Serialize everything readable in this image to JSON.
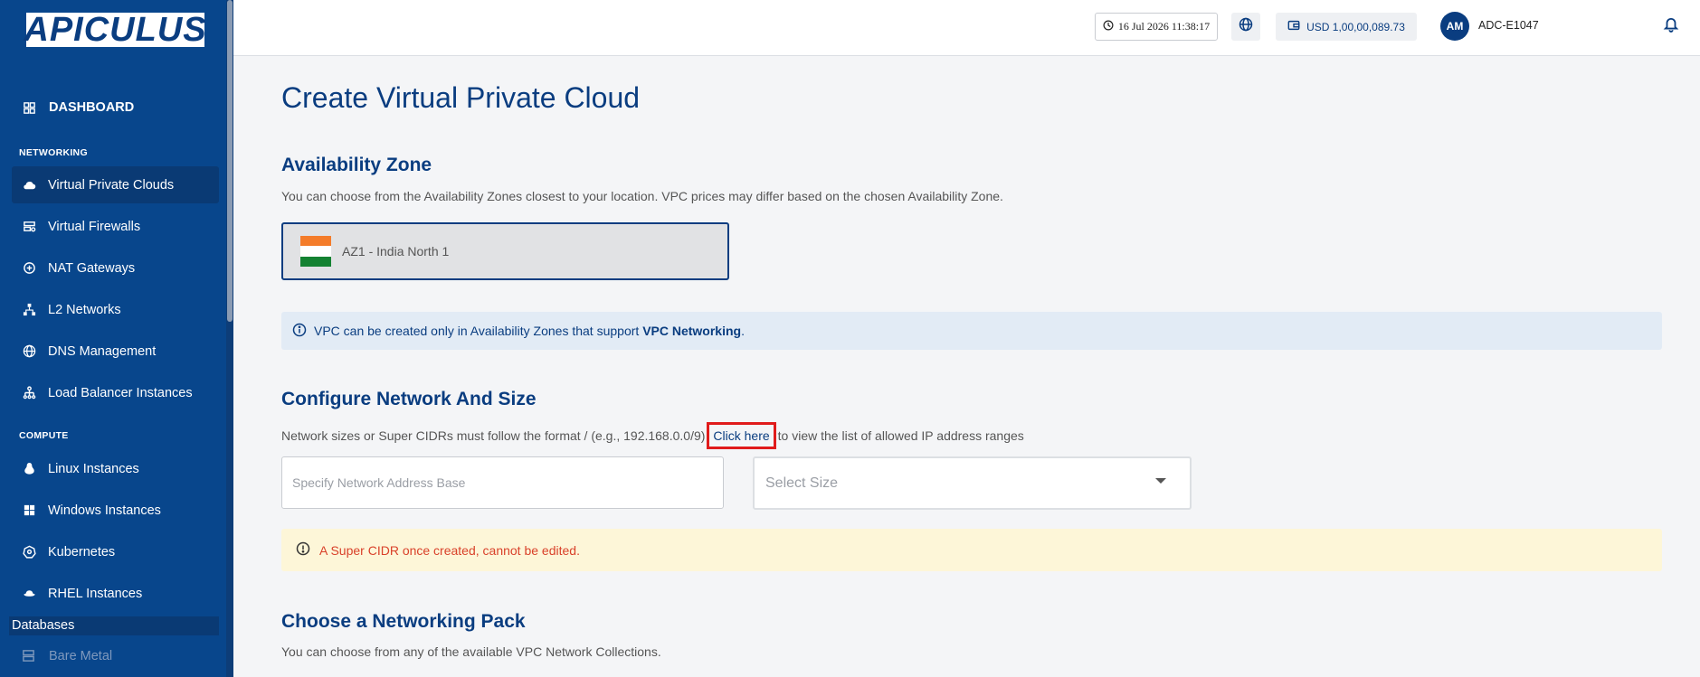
{
  "brand": {
    "logo_text": "APICULUS"
  },
  "sidebar": {
    "dashboard": "DASHBOARD",
    "sections": {
      "networking": "NETWORKING",
      "compute": "COMPUTE"
    },
    "networking_items": [
      {
        "label": "Virtual Private Clouds",
        "icon": "cloud-icon",
        "active": true
      },
      {
        "label": "Virtual Firewalls",
        "icon": "firewall-icon"
      },
      {
        "label": "NAT Gateways",
        "icon": "nat-icon"
      },
      {
        "label": "L2 Networks",
        "icon": "network-icon"
      },
      {
        "label": "DNS Management",
        "icon": "globe-icon"
      },
      {
        "label": "Load Balancer Instances",
        "icon": "load-balancer-icon"
      }
    ],
    "compute_items": [
      {
        "label": "Linux Instances",
        "icon": "linux-icon"
      },
      {
        "label": "Windows Instances",
        "icon": "windows-icon"
      },
      {
        "label": "Kubernetes",
        "icon": "kubernetes-icon"
      },
      {
        "label": "RHEL Instances",
        "icon": "redhat-icon"
      }
    ],
    "databases": "Databases",
    "bare_metal": "Bare Metal"
  },
  "header": {
    "datetime": "16 Jul 2026 11:38:17",
    "balance": "USD 1,00,00,089.73",
    "avatar_initials": "AM",
    "user_id": "ADC-E1047"
  },
  "main": {
    "title": "Create Virtual Private Cloud",
    "availability": {
      "title": "Availability Zone",
      "desc": "You can choose from the Availability Zones closest to your location. VPC prices may differ based on the chosen Availability Zone.",
      "zone_label": "AZ1 - India North 1",
      "info_prefix": "VPC can be created only in Availability Zones that support ",
      "info_bold": "VPC Networking",
      "info_suffix": "."
    },
    "configure": {
      "title": "Configure Network And Size",
      "desc_prefix": "Network sizes or Super CIDRs must follow the format / (e.g., 192.168.0.0/9)",
      "link": "Click here",
      "desc_suffix": "to view the list of allowed IP address ranges",
      "network_placeholder": "Specify Network Address Base",
      "size_placeholder": "Select Size",
      "warning": "A Super CIDR once created, cannot be edited."
    },
    "pack": {
      "title": "Choose a Networking Pack",
      "desc": "You can choose from any of the available VPC Network Collections."
    }
  },
  "colors": {
    "sidebar": "#08468c",
    "accent": "#0a3d80",
    "warning_text": "#d9412a",
    "highlight": "#e01b1b"
  }
}
